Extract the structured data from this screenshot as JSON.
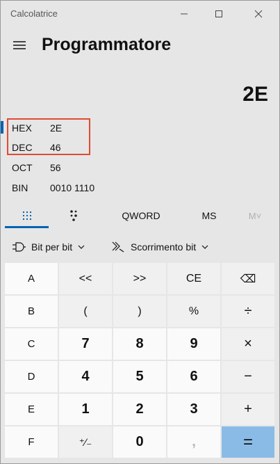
{
  "window": {
    "title": "Calcolatrice",
    "minimize_icon": "minimize-icon",
    "maximize_icon": "maximize-icon",
    "close_icon": "close-icon"
  },
  "header": {
    "menu_icon": "hamburger-menu-icon",
    "mode_title": "Programmatore"
  },
  "display": {
    "result": "2E"
  },
  "radix": [
    {
      "label": "HEX",
      "value": "2E",
      "active": true
    },
    {
      "label": "DEC",
      "value": "46",
      "active": false
    },
    {
      "label": "OCT",
      "value": "56",
      "active": false
    },
    {
      "label": "BIN",
      "value": "0010 1110",
      "active": false
    }
  ],
  "tabs": {
    "keypad_icon": "full-keypad-icon",
    "bit_keypad_icon": "bit-toggle-keypad-icon",
    "word_size": "QWORD",
    "memory_store": "MS",
    "memory_list": "M˅"
  },
  "bit_controls": {
    "bitwise_label": "Bit per bit",
    "bitwise_icon": "logic-gate-icon",
    "shift_label": "Scorrimento bit",
    "shift_icon": "bit-shift-icon"
  },
  "keys": [
    {
      "label": "A",
      "kind": "hexkey",
      "name": "key-a"
    },
    {
      "label": "<<",
      "kind": "fn",
      "name": "key-left-shift"
    },
    {
      "label": ">>",
      "kind": "fn",
      "name": "key-right-shift"
    },
    {
      "label": "CE",
      "kind": "fn",
      "name": "key-clear-entry"
    },
    {
      "label": "⌫",
      "kind": "fn",
      "name": "key-backspace"
    },
    {
      "label": "B",
      "kind": "hexkey",
      "name": "key-b"
    },
    {
      "label": "(",
      "kind": "fn",
      "name": "key-open-paren"
    },
    {
      "label": ")",
      "kind": "fn",
      "name": "key-close-paren"
    },
    {
      "label": "%",
      "kind": "fn",
      "name": "key-modulo"
    },
    {
      "label": "÷",
      "kind": "op",
      "name": "key-divide"
    },
    {
      "label": "C",
      "kind": "hexkey",
      "name": "key-c"
    },
    {
      "label": "7",
      "kind": "num",
      "name": "key-7"
    },
    {
      "label": "8",
      "kind": "num",
      "name": "key-8"
    },
    {
      "label": "9",
      "kind": "num",
      "name": "key-9"
    },
    {
      "label": "×",
      "kind": "op",
      "name": "key-multiply"
    },
    {
      "label": "D",
      "kind": "hexkey",
      "name": "key-d"
    },
    {
      "label": "4",
      "kind": "num",
      "name": "key-4"
    },
    {
      "label": "5",
      "kind": "num",
      "name": "key-5"
    },
    {
      "label": "6",
      "kind": "num",
      "name": "key-6"
    },
    {
      "label": "−",
      "kind": "op",
      "name": "key-subtract"
    },
    {
      "label": "E",
      "kind": "hexkey",
      "name": "key-e"
    },
    {
      "label": "1",
      "kind": "num",
      "name": "key-1"
    },
    {
      "label": "2",
      "kind": "num",
      "name": "key-2"
    },
    {
      "label": "3",
      "kind": "num",
      "name": "key-3"
    },
    {
      "label": "+",
      "kind": "op",
      "name": "key-add"
    },
    {
      "label": "F",
      "kind": "hexkey",
      "name": "key-f"
    },
    {
      "label": "⁺∕₋",
      "kind": "fn",
      "name": "key-negate"
    },
    {
      "label": "0",
      "kind": "num",
      "name": "key-0"
    },
    {
      "label": ",",
      "kind": "disabled",
      "name": "key-decimal"
    },
    {
      "label": "=",
      "kind": "equals",
      "name": "key-equals"
    }
  ],
  "colors": {
    "accent": "#0063b1",
    "equals_bg": "#8abbe6",
    "annotation_box": "#e04b33"
  }
}
